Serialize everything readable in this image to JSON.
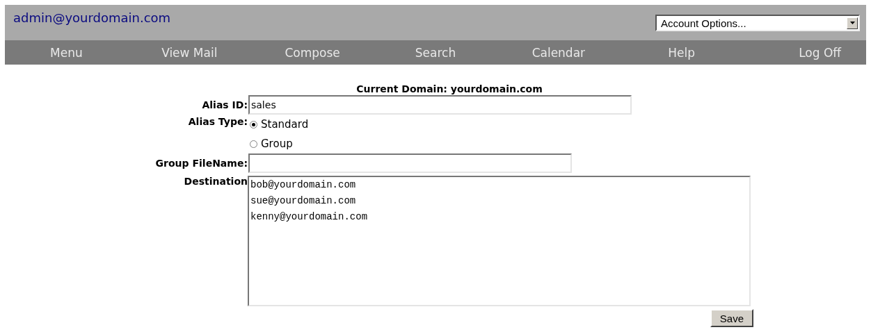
{
  "header": {
    "user": "admin@yourdomain.com",
    "account_select": {
      "value": "Account Options..."
    }
  },
  "nav": [
    {
      "label": "Menu"
    },
    {
      "label": "View Mail"
    },
    {
      "label": "Compose"
    },
    {
      "label": "Search"
    },
    {
      "label": "Calendar"
    },
    {
      "label": "Help"
    },
    {
      "label": "Log Off"
    }
  ],
  "form": {
    "title": "Current Domain: yourdomain.com",
    "alias_id": {
      "label": "Alias ID:",
      "value": "sales"
    },
    "alias_type": {
      "label": "Alias Type:",
      "options": [
        {
          "label": "Standard",
          "selected": true
        },
        {
          "label": "Group",
          "selected": false
        }
      ]
    },
    "group_filename": {
      "label": "Group FileName:"
    },
    "destination": {
      "label": "Destination",
      "value": "bob@yourdomain.com\nsue@yourdomain.com\nkenny@yourdomain.com"
    },
    "save_button": "Save"
  }
}
